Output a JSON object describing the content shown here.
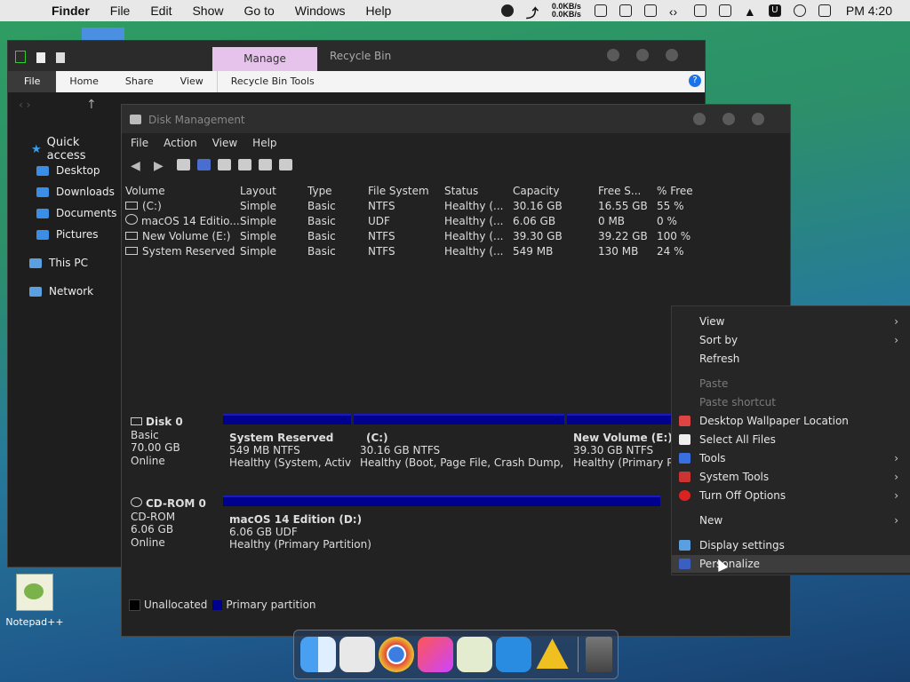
{
  "menubar": {
    "apple": "",
    "items": [
      "Finder",
      "File",
      "Edit",
      "Show",
      "Go to",
      "Windows",
      "Help"
    ],
    "net_up": "0.0KB/s",
    "net_down": "0.0KB/s",
    "clock": "PM 4:20",
    "u_label": "U"
  },
  "explorer": {
    "manage_tab": "Manage",
    "title": "Recycle Bin",
    "ribbon": [
      "File",
      "Home",
      "Share",
      "View",
      "Recycle Bin Tools"
    ],
    "help": "?",
    "nav": {
      "quick": "Quick access",
      "items": [
        "Desktop",
        "Downloads",
        "Documents",
        "Pictures"
      ],
      "this_pc": "This PC",
      "network": "Network"
    }
  },
  "dm": {
    "title": "Disk Management",
    "menu": [
      "File",
      "Action",
      "View",
      "Help"
    ],
    "columns": [
      "Volume",
      "Layout",
      "Type",
      "File System",
      "Status",
      "Capacity",
      "Free S...",
      "% Free"
    ],
    "rows": [
      [
        "(C:)",
        "Simple",
        "Basic",
        "NTFS",
        "Healthy (...",
        "30.16 GB",
        "16.55 GB",
        "55 %"
      ],
      [
        "macOS 14 Editio...",
        "Simple",
        "Basic",
        "UDF",
        "Healthy (...",
        "6.06 GB",
        "0 MB",
        "0 %"
      ],
      [
        "New Volume (E:)",
        "Simple",
        "Basic",
        "NTFS",
        "Healthy (...",
        "39.30 GB",
        "39.22 GB",
        "100 %"
      ],
      [
        "System Reserved",
        "Simple",
        "Basic",
        "NTFS",
        "Healthy (...",
        "549 MB",
        "130 MB",
        "24 %"
      ]
    ],
    "disk0": {
      "name": "Disk 0",
      "type": "Basic",
      "size": "70.00 GB",
      "status": "Online"
    },
    "disk0_parts": [
      {
        "name": "System Reserved",
        "size": "549 MB NTFS",
        "status": "Healthy (System, Activ"
      },
      {
        "name": "(C:)",
        "size": "30.16 GB NTFS",
        "status": "Healthy (Boot, Page File, Crash Dump, F"
      },
      {
        "name": "New Volume  (E:)",
        "size": "39.30 GB NTFS",
        "status": "Healthy (Primary P"
      }
    ],
    "cdrom": {
      "name": "CD-ROM 0",
      "type": "CD-ROM",
      "size": "6.06 GB",
      "status": "Online"
    },
    "cdrom_part": {
      "name": "macOS 14 Edition  (D:)",
      "size": "6.06 GB UDF",
      "status": "Healthy (Primary Partition)"
    },
    "legend": [
      "Unallocated",
      "Primary partition"
    ]
  },
  "context_menu": {
    "items": [
      {
        "label": "View",
        "arrow": true
      },
      {
        "label": "Sort by",
        "arrow": true
      },
      {
        "label": "Refresh"
      },
      {
        "label": "Paste",
        "disabled": true
      },
      {
        "label": "Paste shortcut",
        "disabled": true
      },
      {
        "label": "Desktop Wallpaper Location"
      },
      {
        "label": "Select All Files"
      },
      {
        "label": "Tools",
        "arrow": true
      },
      {
        "label": "System Tools",
        "arrow": true
      },
      {
        "label": "Turn Off Options",
        "arrow": true
      },
      {
        "label": "New",
        "arrow": true
      },
      {
        "label": "Display settings"
      },
      {
        "label": "Personalize"
      }
    ],
    "arrow_glyph": "›"
  },
  "desktop": {
    "notepad": "Notepad++"
  },
  "colors": {
    "partition": "#00008f",
    "accent": "#1a73e8",
    "manage_tab": "#e6c3ea"
  }
}
